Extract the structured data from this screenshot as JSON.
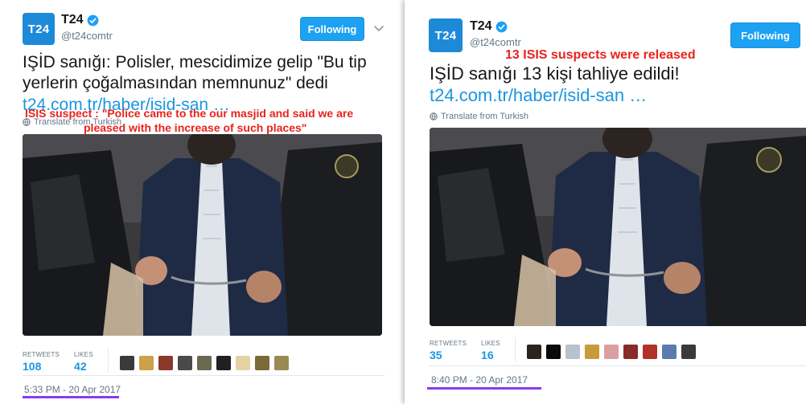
{
  "left": {
    "avatar_text": "T24",
    "display_name": "T24",
    "handle": "@t24comtr",
    "follow_label": "Following",
    "tweet_line1": "IŞİD sanığı: Polisler, mescidimize gelip \"Bu tip",
    "tweet_line2": "yerlerin çoğalmasından memnunuz\" dedi",
    "tweet_link": "t24.com.tr/haber/isid-san …",
    "translate_label": "Translate from Turkish",
    "annotation_line1": "ISIS suspect : \"Police came to the our masjid and said we are",
    "annotation_line2": "pleased with the increase of such places\"",
    "retweets_label": "RETWEETS",
    "retweets_value": "108",
    "likes_label": "LIKES",
    "likes_value": "42",
    "timestamp": "5:33 PM - 20 Apr 2017"
  },
  "right": {
    "avatar_text": "T24",
    "display_name": "T24",
    "handle": "@t24comtr",
    "follow_label": "Following",
    "annotation": "13 ISIS suspects were released",
    "tweet_line1": "IŞİD sanığı 13 kişi tahliye edildi!",
    "tweet_link": "t24.com.tr/haber/isid-san …",
    "translate_label": "Translate from Turkish",
    "retweets_label": "RETWEETS",
    "retweets_value": "35",
    "likes_label": "LIKES",
    "likes_value": "16",
    "timestamp": "8:40 PM - 20 Apr 2017"
  },
  "icons": {
    "verified": "verified-badge-icon",
    "globe": "globe-icon",
    "chevron": "chevron-down-icon"
  },
  "colors": {
    "brand_blue": "#1da1f2",
    "link_blue": "#1b95e0",
    "annotation_red": "#e8231d",
    "underline_purple": "#8a3bea",
    "avatar_blue": "#1d8ad8"
  }
}
